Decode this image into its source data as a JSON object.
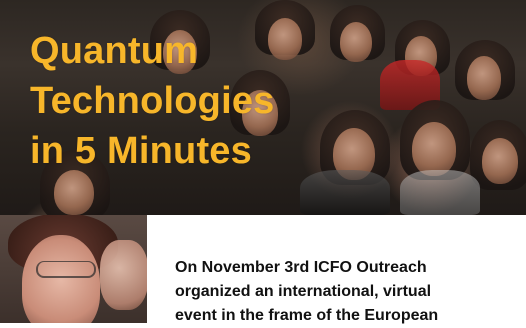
{
  "article": {
    "title_lines": [
      "Quantum",
      "Technologies",
      "in 5 Minutes"
    ],
    "body_lines": [
      "On November 3rd ICFO Outreach",
      "organized an international, virtual",
      "event in the frame of the European"
    ]
  },
  "colors": {
    "title": "#f7b62a",
    "body_text": "#111111",
    "panel": "#ffffff"
  }
}
